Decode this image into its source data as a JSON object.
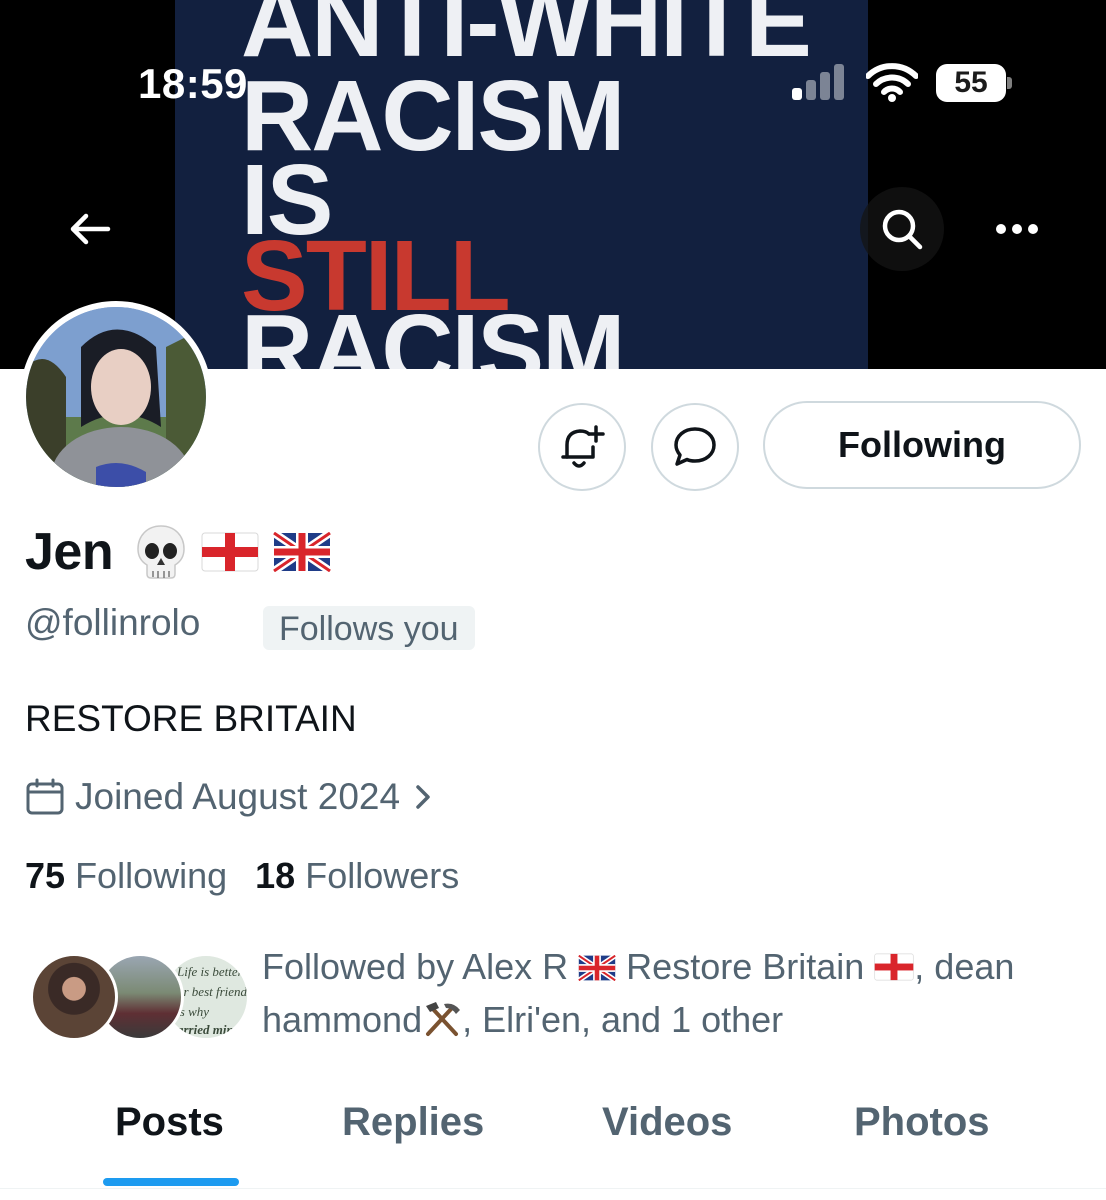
{
  "status_bar": {
    "time": "18:59",
    "battery": "55"
  },
  "banner": {
    "poster_lines": [
      "ANTI-WHITE",
      "RACISM",
      "IS",
      "STILL",
      "RACISM."
    ]
  },
  "nav": {
    "back_icon": "arrow-left-icon",
    "search_icon": "search-icon",
    "more_icon": "ellipsis-icon"
  },
  "actions": {
    "notify_icon": "bell-plus-icon",
    "message_icon": "chat-bubble-icon",
    "following_label": "Following"
  },
  "profile": {
    "display_name": "Jen",
    "name_emojis": [
      "skull-emoji",
      "england-flag-emoji",
      "uk-flag-emoji"
    ],
    "handle": "@follinrolo",
    "follows_you": "Follows you",
    "bio": "RESTORE BRITAIN",
    "joined": "Joined August 2024"
  },
  "stats": {
    "following_count": "75",
    "following_label": "Following",
    "followers_count": "18",
    "followers_label": "Followers"
  },
  "followed_by": {
    "prefix": "Followed by Alex R",
    "part2": "Restore Britain",
    "part3": ", dean",
    "part4": "hammond",
    "part5": ", Elri'en, and 1 other",
    "avatar3_text": [
      "Life is better",
      "ur best friend,",
      "'s why",
      "arried min"
    ]
  },
  "tabs": [
    "Posts",
    "Replies",
    "Videos",
    "Photos"
  ],
  "colors": {
    "accent": "#1d9bf0",
    "text_primary": "#0f1419",
    "text_secondary": "#536471",
    "poster_bg": "#12203f",
    "poster_red": "#c8392f"
  }
}
